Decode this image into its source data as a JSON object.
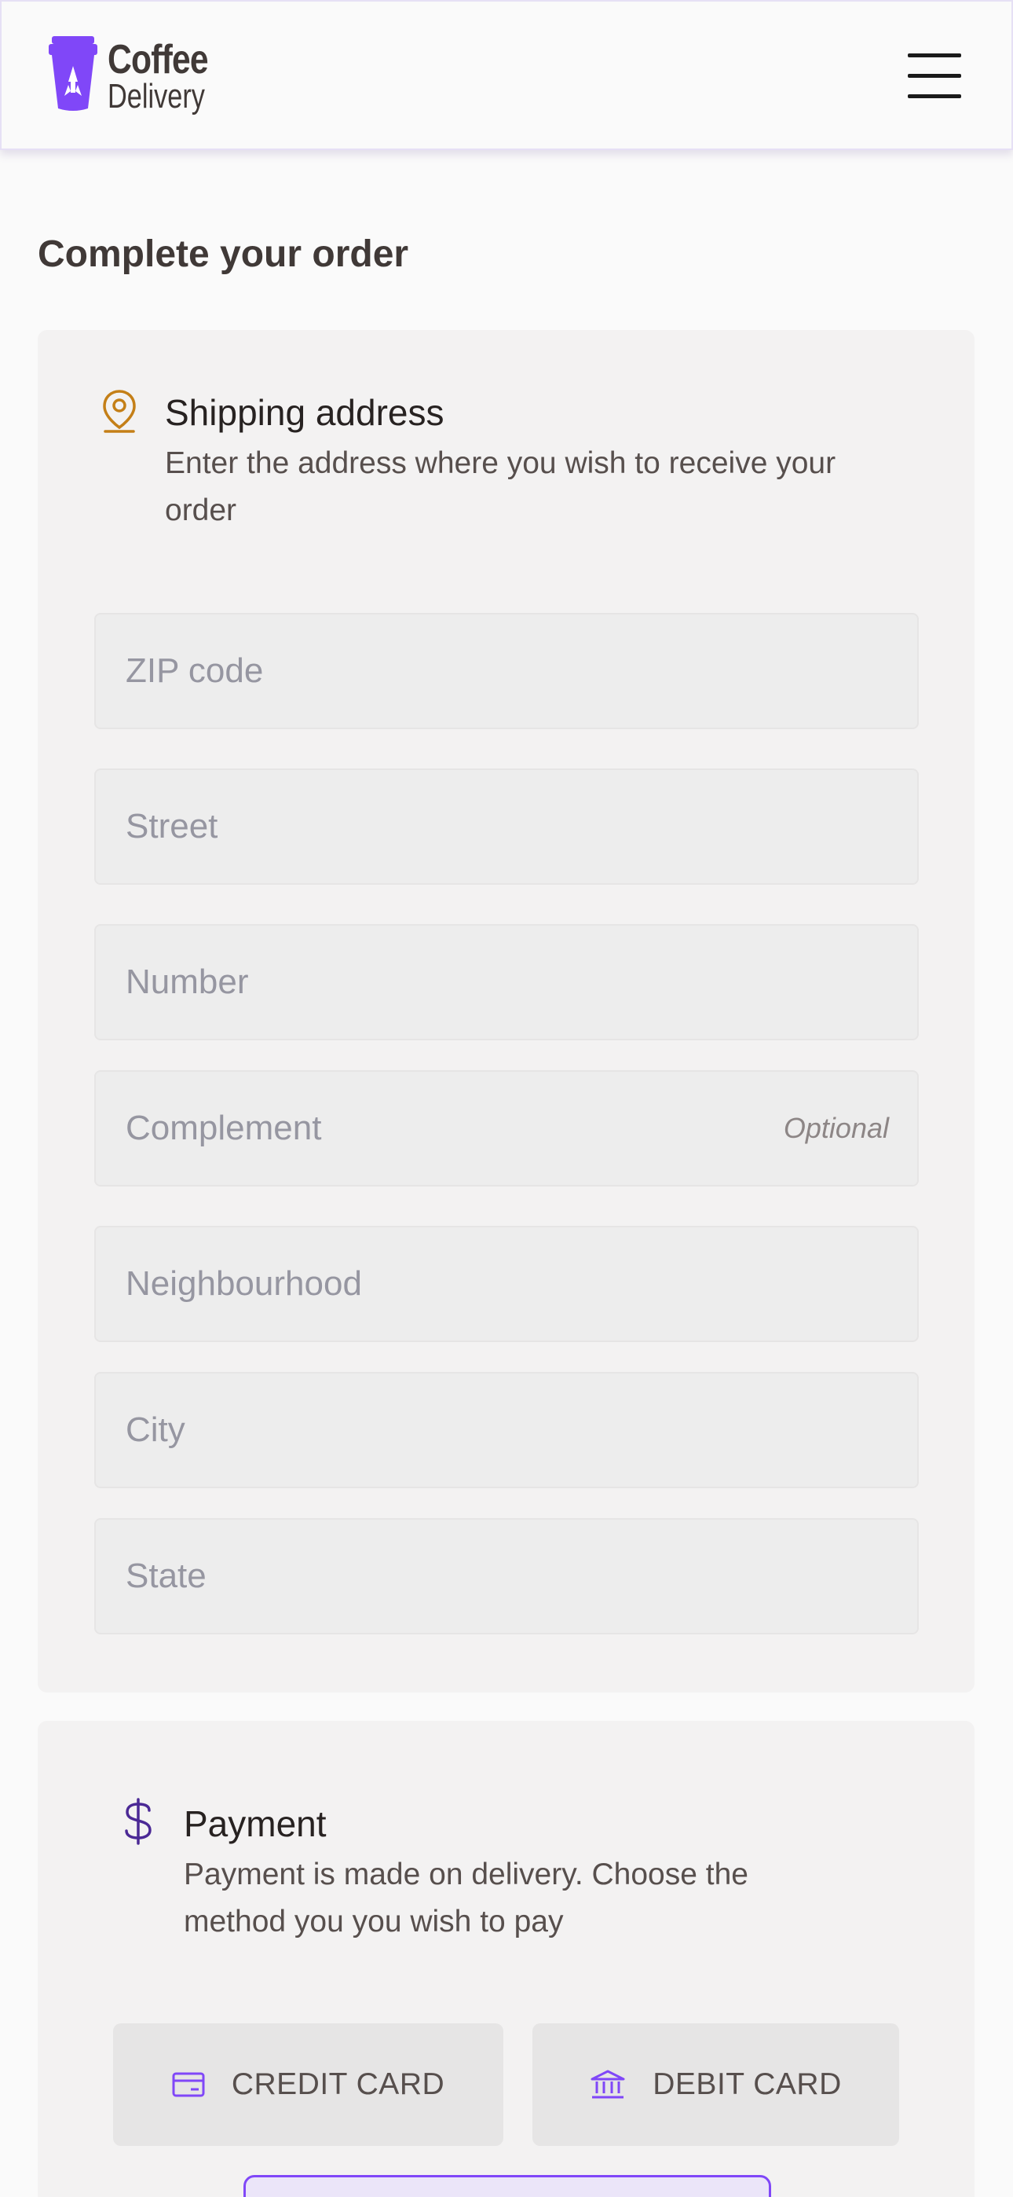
{
  "header": {
    "logo_line1": "Coffee",
    "logo_line2": "Delivery",
    "menu_icon": "hamburger-menu-icon"
  },
  "page": {
    "title": "Complete your order"
  },
  "address": {
    "icon": "map-pin-icon",
    "title": "Shipping address",
    "subtitle": "Enter the address where you wish to receive your order",
    "fields": {
      "zip": "ZIP code",
      "street": "Street",
      "number": "Number",
      "complement": "Complement",
      "complement_optional": "Optional",
      "neighbourhood": "Neighbourhood",
      "city": "City",
      "state": "State"
    }
  },
  "payment": {
    "icon": "dollar-sign-icon",
    "title": "Payment",
    "subtitle": "Payment is made on delivery. Choose the method you you wish to pay",
    "credit_label": "CREDIT CARD",
    "credit_icon": "credit-card-icon",
    "debit_label": "DEBIT CARD",
    "debit_icon": "bank-icon"
  },
  "colors": {
    "brand_purple": "#8047f8",
    "accent_yellow": "#c47f17",
    "dark_purple": "#4b2995"
  }
}
